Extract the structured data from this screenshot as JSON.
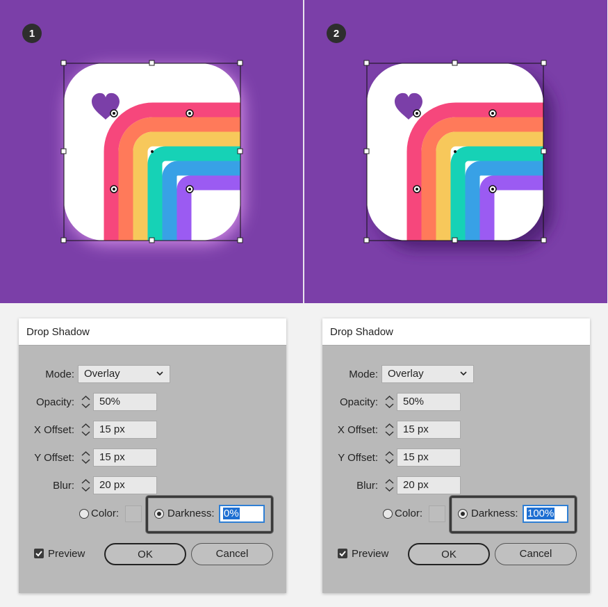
{
  "steps": [
    {
      "number": "1"
    },
    {
      "number": "2"
    }
  ],
  "colors": {
    "background": "#7b3fa8",
    "heart": "#7b3fa8",
    "rainbow": [
      "#f6477c",
      "#ff7a5a",
      "#f7c85b",
      "#16d2b6",
      "#38a1e6",
      "#9b5bf2"
    ],
    "selection": "#1e6fd2"
  },
  "dialogs": [
    {
      "title": "Drop Shadow",
      "mode_label": "Mode:",
      "mode_value": "Overlay",
      "opacity_label": "Opacity:",
      "opacity_value": "50%",
      "x_offset_label": "X Offset:",
      "x_offset_value": "15 px",
      "y_offset_label": "Y Offset:",
      "y_offset_value": "15 px",
      "blur_label": "Blur:",
      "blur_value": "20 px",
      "color_label": "Color:",
      "darkness_label": "Darkness:",
      "darkness_value": "0%",
      "preview_label": "Preview",
      "ok_label": "OK",
      "cancel_label": "Cancel"
    },
    {
      "title": "Drop Shadow",
      "mode_label": "Mode:",
      "mode_value": "Overlay",
      "opacity_label": "Opacity:",
      "opacity_value": "50%",
      "x_offset_label": "X Offset:",
      "x_offset_value": "15 px",
      "y_offset_label": "Y Offset:",
      "y_offset_value": "15 px",
      "blur_label": "Blur:",
      "blur_value": "20 px",
      "color_label": "Color:",
      "darkness_label": "Darkness:",
      "darkness_value": "100%",
      "preview_label": "Preview",
      "ok_label": "OK",
      "cancel_label": "Cancel"
    }
  ]
}
